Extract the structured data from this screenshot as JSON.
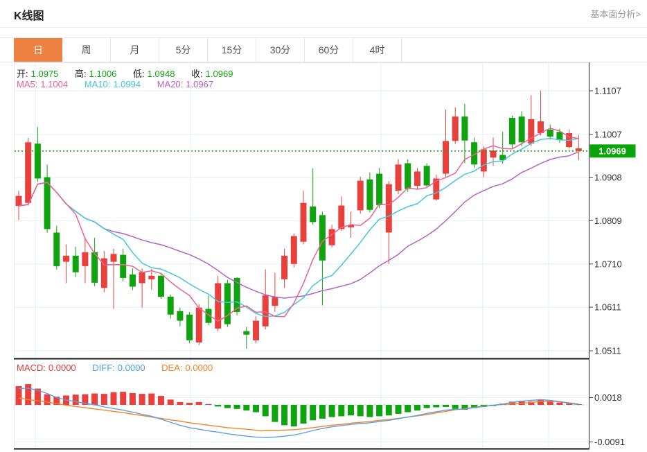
{
  "header": {
    "title": "K线图",
    "analysis_link": "基本面分析>"
  },
  "tabs": {
    "items": [
      {
        "name": "tab-day",
        "label": "日",
        "active": true
      },
      {
        "name": "tab-week",
        "label": "周",
        "active": false
      },
      {
        "name": "tab-month",
        "label": "月",
        "active": false
      },
      {
        "name": "tab-5min",
        "label": "5分",
        "active": false
      },
      {
        "name": "tab-15min",
        "label": "15分",
        "active": false
      },
      {
        "name": "tab-30min",
        "label": "30分",
        "active": false
      },
      {
        "name": "tab-60min",
        "label": "60分",
        "active": false
      },
      {
        "name": "tab-4hour",
        "label": "4时",
        "active": false
      }
    ]
  },
  "ohlc_legend": {
    "open_label": "开:",
    "open": "1.0975",
    "high_label": "高:",
    "high": "1.1006",
    "low_label": "低:",
    "low": "1.0948",
    "close_label": "收:",
    "close": "1.0969"
  },
  "ma_legend": {
    "ma5_label": "MA5:",
    "ma5": "1.1004",
    "ma10_label": "MA10:",
    "ma10": "1.0994",
    "ma20_label": "MA20:",
    "ma20": "1.0967"
  },
  "macd_legend": {
    "macd_label": "MACD:",
    "macd": "0.0000",
    "diff_label": "DIFF:",
    "diff": "0.0000",
    "dea_label": "DEA:",
    "dea": "0.0000"
  },
  "price_tag": "1.0969",
  "colors": {
    "up_red": "#e8403d",
    "down_green": "#0fa40d",
    "ma5_pink": "#ee6192",
    "ma10_cyan": "#43c5dd",
    "ma20_purple": "#b561c8",
    "diff_blue": "#5b9fe0",
    "dea_orange": "#f08428",
    "tag_green": "#0aa30a",
    "dotted_green": "#1ca81c",
    "tab_orange": "#ee8242",
    "grid": "#e4edf6",
    "axis": "#444444",
    "tick_text": "#333333",
    "pane_border": "#141414",
    "zero_dash_blue": "#9fccea"
  },
  "chart_data": {
    "type": "candlestick",
    "panes": [
      {
        "name": "price-pane",
        "y_ticks": [
          1.1107,
          1.1007,
          1.0908,
          1.0809,
          1.071,
          1.0611,
          1.0511
        ],
        "current_price": 1.0969,
        "ma_periods": [
          5,
          10,
          20
        ],
        "candles_ohlc": [
          [
            1.0866,
            1.0878,
            1.0811,
            1.0843
          ],
          [
            1.0989,
            1.0999,
            1.0844,
            1.085
          ],
          [
            1.0906,
            1.1024,
            1.0898,
            1.0986
          ],
          [
            1.079,
            1.0938,
            1.0782,
            1.0909
          ],
          [
            1.0705,
            1.0798,
            1.0697,
            1.0782
          ],
          [
            1.0729,
            1.0755,
            1.0666,
            1.0715
          ],
          [
            1.0691,
            1.075,
            1.068,
            1.0729
          ],
          [
            1.0737,
            1.0771,
            1.0666,
            1.0705
          ],
          [
            1.0667,
            1.077,
            1.0659,
            1.0737
          ],
          [
            1.0723,
            1.074,
            1.0645,
            1.0655
          ],
          [
            1.0733,
            1.0745,
            1.0607,
            1.0715
          ],
          [
            1.0678,
            1.0745,
            1.067,
            1.0731
          ],
          [
            1.0658,
            1.07,
            1.065,
            1.0686
          ],
          [
            1.0691,
            1.07,
            1.061,
            1.0666
          ],
          [
            1.0683,
            1.0699,
            1.0651,
            1.0675
          ],
          [
            1.0635,
            1.069,
            1.063,
            1.0683
          ],
          [
            1.0594,
            1.064,
            1.0585,
            1.0635
          ],
          [
            1.058,
            1.061,
            1.0567,
            1.0602
          ],
          [
            1.0535,
            1.06,
            1.0528,
            1.0594
          ],
          [
            1.061,
            1.0618,
            1.0524,
            1.053
          ],
          [
            1.0575,
            1.0638,
            1.057,
            1.0607
          ],
          [
            1.0666,
            1.0683,
            1.0556,
            1.0562
          ],
          [
            1.0572,
            1.0674,
            1.0566,
            1.0666
          ],
          [
            1.06,
            1.068,
            1.0592,
            1.0678
          ],
          [
            1.0548,
            1.0566,
            1.0516,
            1.0556
          ],
          [
            1.058,
            1.059,
            1.0528,
            1.0535
          ],
          [
            1.0638,
            1.0698,
            1.056,
            1.0567
          ],
          [
            1.0634,
            1.069,
            1.06,
            1.0614
          ],
          [
            1.0729,
            1.0745,
            1.0655,
            1.0675
          ],
          [
            1.0774,
            1.078,
            1.0702,
            1.071
          ],
          [
            1.085,
            1.0878,
            1.0755,
            1.0761
          ],
          [
            1.0806,
            1.0929,
            1.08,
            1.0842
          ],
          [
            1.0718,
            1.083,
            1.0615,
            1.0822
          ],
          [
            1.079,
            1.08,
            1.0748,
            1.0753
          ],
          [
            1.0844,
            1.0865,
            1.0786,
            1.079
          ],
          [
            1.0799,
            1.083,
            1.077,
            1.0794
          ],
          [
            1.0901,
            1.091,
            1.0825,
            1.0833
          ],
          [
            1.0834,
            1.092,
            1.0828,
            1.0904
          ],
          [
            1.0845,
            1.093,
            1.0838,
            1.0917
          ],
          [
            1.0893,
            1.09,
            1.071,
            1.0782
          ],
          [
            1.0938,
            1.095,
            1.087,
            1.0878
          ],
          [
            1.0882,
            1.095,
            1.0875,
            1.0941
          ],
          [
            1.0922,
            1.093,
            1.088,
            1.0889
          ],
          [
            1.089,
            1.0941,
            1.0885,
            1.0935
          ],
          [
            1.0906,
            1.0915,
            1.0855,
            1.0858
          ],
          [
            1.0992,
            1.1064,
            1.091,
            1.0917
          ],
          [
            1.1048,
            1.1069,
            1.0985,
            1.0992
          ],
          [
            1.0993,
            1.1077,
            1.0941,
            1.1048
          ],
          [
            1.0938,
            1.1,
            1.093,
            1.0989
          ],
          [
            1.0973,
            1.098,
            1.0909,
            1.0922
          ],
          [
            1.097,
            1.1,
            1.0935,
            1.0954
          ],
          [
            1.0948,
            1.1013,
            1.094,
            1.096
          ],
          [
            1.0984,
            1.105,
            1.0975,
            1.1045
          ],
          [
            1.0989,
            1.106,
            1.098,
            1.1048
          ],
          [
            1.1042,
            1.1097,
            1.098,
            1.0986
          ],
          [
            1.1037,
            1.1107,
            1.1005,
            1.101
          ],
          [
            1.1002,
            1.103,
            1.0995,
            1.1018
          ],
          [
            1.0994,
            1.102,
            1.0988,
            1.1013
          ],
          [
            1.101,
            1.1018,
            1.0975,
            1.0978
          ],
          [
            1.0975,
            1.1006,
            1.0948,
            1.0969
          ]
        ]
      },
      {
        "name": "macd-pane",
        "y_ticks": [
          0.0018,
          -0.0091
        ],
        "histogram": [
          0.0046,
          0.0051,
          0.004,
          0.0026,
          0.002,
          0.0023,
          0.0025,
          0.0026,
          0.0028,
          0.0027,
          0.0031,
          0.0032,
          0.0029,
          0.0027,
          0.0028,
          0.0022,
          0.0013,
          0.0007,
          0.0005,
          0.0007,
          0.0002,
          -0.0004,
          -0.0008,
          -0.001,
          -0.0014,
          -0.0018,
          -0.0028,
          -0.0042,
          -0.005,
          -0.0053,
          -0.0046,
          -0.0038,
          -0.0034,
          -0.003,
          -0.0028,
          -0.0026,
          -0.0028,
          -0.003,
          -0.0028,
          -0.0026,
          -0.0022,
          -0.0018,
          -0.0014,
          -0.0008,
          -0.0006,
          -0.0005,
          -0.001,
          -0.0012,
          -0.0008,
          -0.0005,
          -0.0003,
          0.0003,
          0.0008,
          0.001,
          0.0008,
          0.0013,
          0.0009,
          0.0006,
          0.0003,
          0.0001
        ],
        "diff": [
          0.004,
          0.0041,
          0.0036,
          0.0028,
          0.0018,
          0.0012,
          0.0008,
          0.0004,
          0.0,
          -0.0005,
          -0.0009,
          -0.0013,
          -0.0018,
          -0.0023,
          -0.0028,
          -0.0035,
          -0.0043,
          -0.005,
          -0.0056,
          -0.006,
          -0.0064,
          -0.0067,
          -0.0071,
          -0.0074,
          -0.0077,
          -0.0079,
          -0.008,
          -0.0079,
          -0.0077,
          -0.0074,
          -0.0069,
          -0.0063,
          -0.0058,
          -0.0054,
          -0.0051,
          -0.0048,
          -0.0046,
          -0.0044,
          -0.0041,
          -0.0038,
          -0.0034,
          -0.003,
          -0.0026,
          -0.0021,
          -0.0017,
          -0.0013,
          -0.0011,
          -0.001,
          -0.0007,
          -0.0004,
          -0.0001,
          0.0002,
          0.0006,
          0.0009,
          0.0011,
          0.0013,
          0.0011,
          0.0008,
          0.0004,
          0.0001
        ],
        "dea": [
          0.0017,
          0.0013,
          0.001,
          0.0007,
          0.0003,
          -0.0001,
          -0.0004,
          -0.0007,
          -0.001,
          -0.0013,
          -0.0016,
          -0.0019,
          -0.0023,
          -0.0026,
          -0.003,
          -0.0033,
          -0.0037,
          -0.004,
          -0.0044,
          -0.0047,
          -0.005,
          -0.0053,
          -0.0056,
          -0.0058,
          -0.006,
          -0.0062,
          -0.0063,
          -0.0063,
          -0.0062,
          -0.0061,
          -0.0059,
          -0.0056,
          -0.0053,
          -0.005,
          -0.0048,
          -0.0045,
          -0.0043,
          -0.0041,
          -0.0038,
          -0.0036,
          -0.0033,
          -0.003,
          -0.0027,
          -0.0024,
          -0.002,
          -0.0016,
          -0.0012,
          -0.0009,
          -0.0006,
          -0.0003,
          -0.0001,
          0.0001,
          0.0002,
          0.0004,
          0.0006,
          0.0008,
          0.0009,
          0.0008,
          0.0005,
          0.0002
        ]
      }
    ]
  }
}
